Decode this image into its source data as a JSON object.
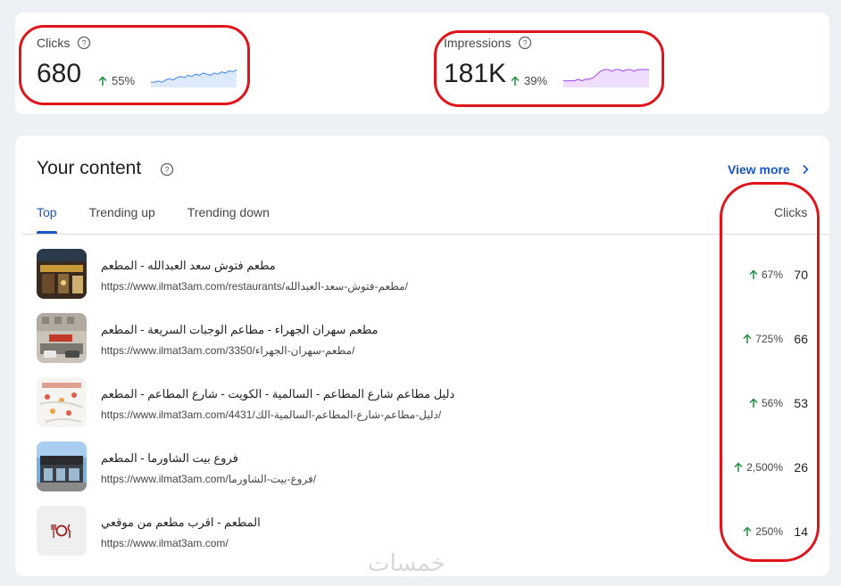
{
  "metrics": {
    "clicks": {
      "label": "Clicks",
      "value": "680",
      "change": "55%",
      "color": "#4285f4",
      "trend": [
        3,
        3,
        4,
        3,
        5,
        6,
        5,
        7,
        8,
        7,
        9,
        8,
        10,
        9,
        11,
        10,
        9,
        11,
        10,
        12,
        11,
        13,
        12,
        14
      ]
    },
    "impressions": {
      "label": "Impressions",
      "value": "181K",
      "change": "39%",
      "color": "#a142f4",
      "trend": [
        3,
        3,
        3,
        3,
        4,
        3,
        4,
        4,
        5,
        7,
        9,
        10,
        10,
        9,
        10,
        10,
        9,
        10,
        10,
        9,
        10,
        10,
        10,
        10
      ]
    }
  },
  "content": {
    "title": "Your content",
    "view_more": "View more",
    "tabs": [
      "Top",
      "Trending up",
      "Trending down"
    ],
    "column_header": "Clicks",
    "rows": [
      {
        "title": "مطعم فتوش سعد العبدالله - المطعم",
        "url": "https://www.ilmat3am.com/restaurants/مطعم-فتوش-سعد-العبدالله/",
        "change": "67%",
        "clicks": "70",
        "thumb": "storefront-photo"
      },
      {
        "title": "مطعم سهران الجهراء - مطاعم الوجبات السريعة - المطعم",
        "url": "https://www.ilmat3am.com/3350/مطعم-سهران-الجهراء/",
        "change": "725%",
        "clicks": "66",
        "thumb": "building-photo"
      },
      {
        "title": "دليل مطاعم شارع المطاعم - السالمية - الكويت - شارع المطاعم - المطعم",
        "url": "https://www.ilmat3am.com/4431/دليل-مطاعم-شارع-المطاعم-السالمية-الك/",
        "change": "56%",
        "clicks": "53",
        "thumb": "map-photo"
      },
      {
        "title": "فروع بيت الشاورما - المطعم",
        "url": "https://www.ilmat3am.com/فروع-بيت-الشاورما/",
        "change": "2,500%",
        "clicks": "26",
        "thumb": "shop-photo"
      },
      {
        "title": "المطعم - اقرب مطعم من موقعي",
        "url": "https://www.ilmat3am.com/",
        "change": "250%",
        "clicks": "14",
        "thumb": "restaurant-icon"
      }
    ]
  },
  "watermark": "خمسات"
}
